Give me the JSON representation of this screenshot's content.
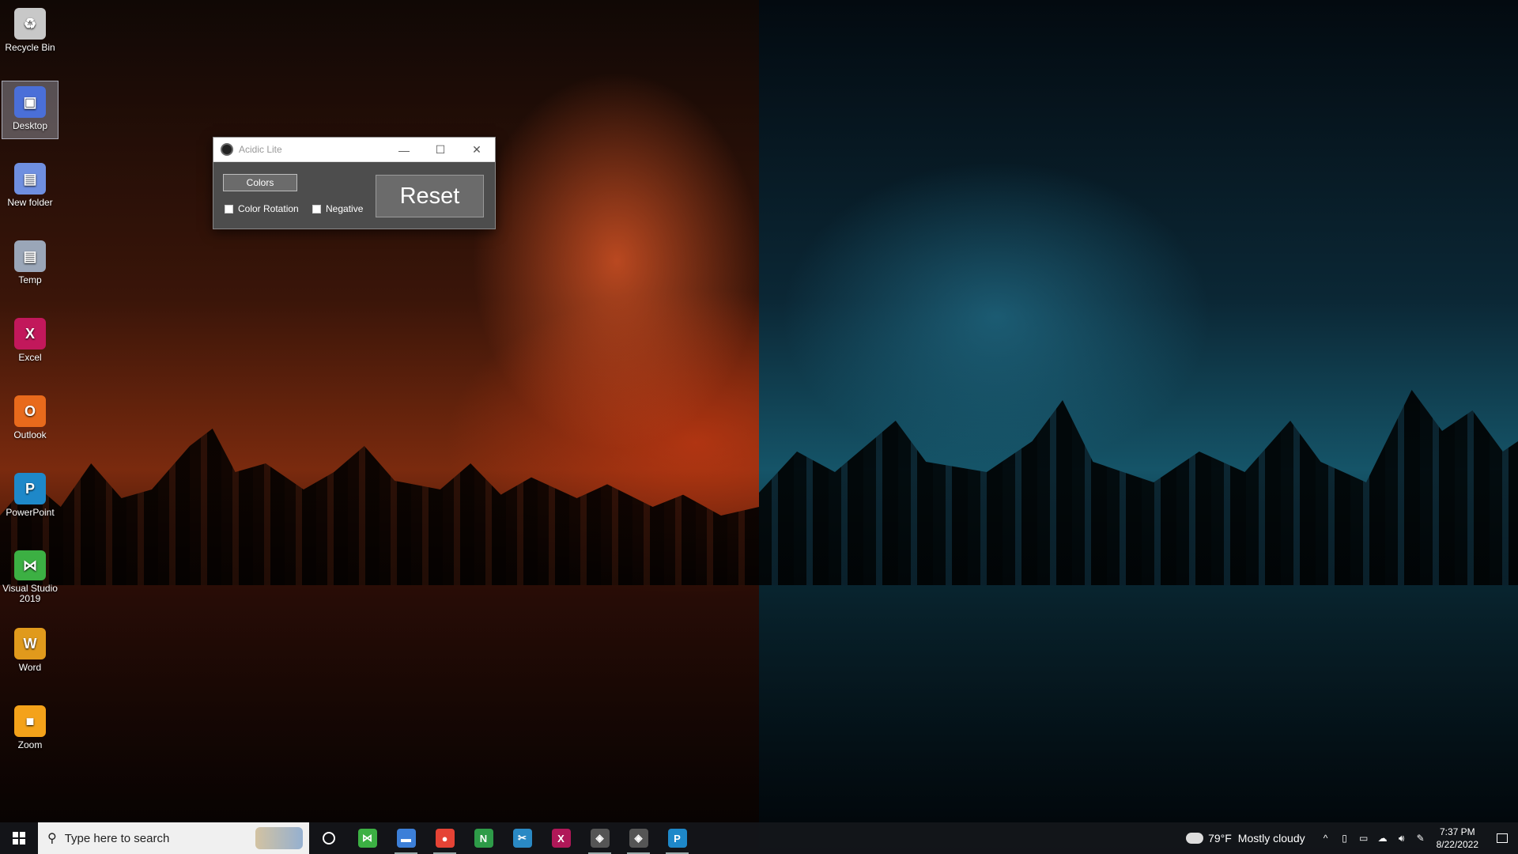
{
  "desktop": {
    "icons": [
      {
        "label": "Recycle Bin",
        "glyph": "recycle-bin-icon",
        "color": "#c8c8c8",
        "char": "♻"
      },
      {
        "label": "Desktop",
        "glyph": "desktop-folder-icon",
        "color": "#4a6fd8",
        "char": "▣",
        "selected": true
      },
      {
        "label": "New folder",
        "glyph": "folder-icon",
        "color": "#6f8fe0",
        "char": "▤"
      },
      {
        "label": "Temp",
        "glyph": "folder-icon",
        "color": "#9aa6b8",
        "char": "▤"
      },
      {
        "label": "Excel",
        "glyph": "excel-icon",
        "color": "#c2185b",
        "char": "X"
      },
      {
        "label": "Outlook",
        "glyph": "outlook-icon",
        "color": "#e86a1c",
        "char": "O"
      },
      {
        "label": "PowerPoint",
        "glyph": "powerpoint-icon",
        "color": "#1e88c9",
        "char": "P"
      },
      {
        "label": "Visual Studio 2019",
        "glyph": "visual-studio-icon",
        "color": "#3cb043",
        "char": "⋈"
      },
      {
        "label": "Word",
        "glyph": "word-icon",
        "color": "#e09a1c",
        "char": "W"
      },
      {
        "label": "Zoom",
        "glyph": "zoom-icon",
        "color": "#f4a21a",
        "char": "■"
      }
    ]
  },
  "app_window": {
    "title": "Acidic Lite",
    "colors_button": "Colors",
    "color_rotation_label": "Color Rotation",
    "color_rotation_checked": false,
    "negative_label": "Negative",
    "negative_checked": false,
    "reset_button": "Reset",
    "controls": {
      "minimize": "—",
      "maximize": "☐",
      "close": "✕"
    }
  },
  "taskbar": {
    "search_placeholder": "Type here to search",
    "apps": [
      {
        "name": "cortana",
        "running": false
      },
      {
        "name": "visual-studio",
        "color": "#3cb043",
        "char": "⋈",
        "running": false
      },
      {
        "name": "file-explorer",
        "color": "#3c7fd8",
        "char": "▬",
        "running": true
      },
      {
        "name": "chrome",
        "color": "#e54335",
        "char": "●",
        "running": true
      },
      {
        "name": "onenote",
        "color": "#2e9b48",
        "char": "N",
        "running": false
      },
      {
        "name": "snipping-tool",
        "color": "#2a89c4",
        "char": "✂",
        "running": false
      },
      {
        "name": "excel-dark",
        "color": "#b01858",
        "char": "X",
        "running": false
      },
      {
        "name": "acidic",
        "color": "#555",
        "char": "◈",
        "running": true
      },
      {
        "name": "acidic-2",
        "color": "#555",
        "char": "◈",
        "running": true
      },
      {
        "name": "powerpoint",
        "color": "#1e88c9",
        "char": "P",
        "running": true
      }
    ],
    "weather": {
      "temp": "79°F",
      "condition": "Mostly cloudy"
    },
    "clock": {
      "time": "7:37 PM",
      "date": "8/22/2022"
    }
  }
}
